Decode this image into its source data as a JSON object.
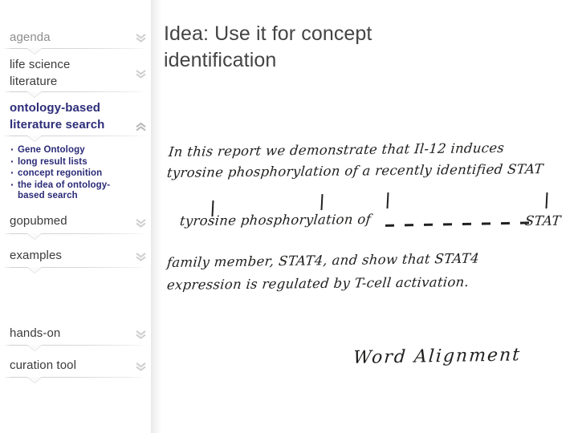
{
  "slide": {
    "title": "Idea: Use it for concept\nidentification"
  },
  "sidebar": {
    "items": [
      {
        "label": "agenda",
        "state": "muted",
        "chevron": "chevron-down-double-icon"
      },
      {
        "label": "life science\nliterature",
        "state": "normal",
        "chevron": "chevron-down-double-icon"
      },
      {
        "label": "ontology-based\nliterature search",
        "state": "active",
        "chevron": "chevron-up-double-icon"
      },
      {
        "label": "gopubmed",
        "state": "normal",
        "chevron": "chevron-down-double-icon"
      },
      {
        "label": "examples",
        "state": "normal",
        "chevron": "chevron-down-double-icon"
      },
      {
        "label": "hands-on",
        "state": "normal",
        "chevron": "chevron-down-double-icon"
      },
      {
        "label": "curation tool",
        "state": "normal",
        "chevron": "chevron-down-double-icon"
      }
    ],
    "sub_items": [
      "Gene Ontology",
      "long result lists",
      "concept regonition",
      "the idea of ontology-\nbased search"
    ]
  },
  "handwriting": {
    "line1": "In this report we demonstrate that Il-12 induces",
    "line2": "tyrosine phosphorylation of a recently identified STAT",
    "line3": "tyrosine phosphorylation of",
    "line3_dashes": "- - - - - - - -",
    "line3_end": "STAT",
    "line4": "family member, STAT4, and show that STAT4",
    "line5": "expression is regulated by T-cell activation.",
    "caption": "Word Alignment"
  },
  "colors": {
    "active_nav": "#2d2d7a",
    "bullet_text": "#2b2b78",
    "nav_text": "#3a3a3a",
    "nav_muted": "#8d8d8d",
    "title_text": "#444444",
    "ink": "#20201f"
  }
}
